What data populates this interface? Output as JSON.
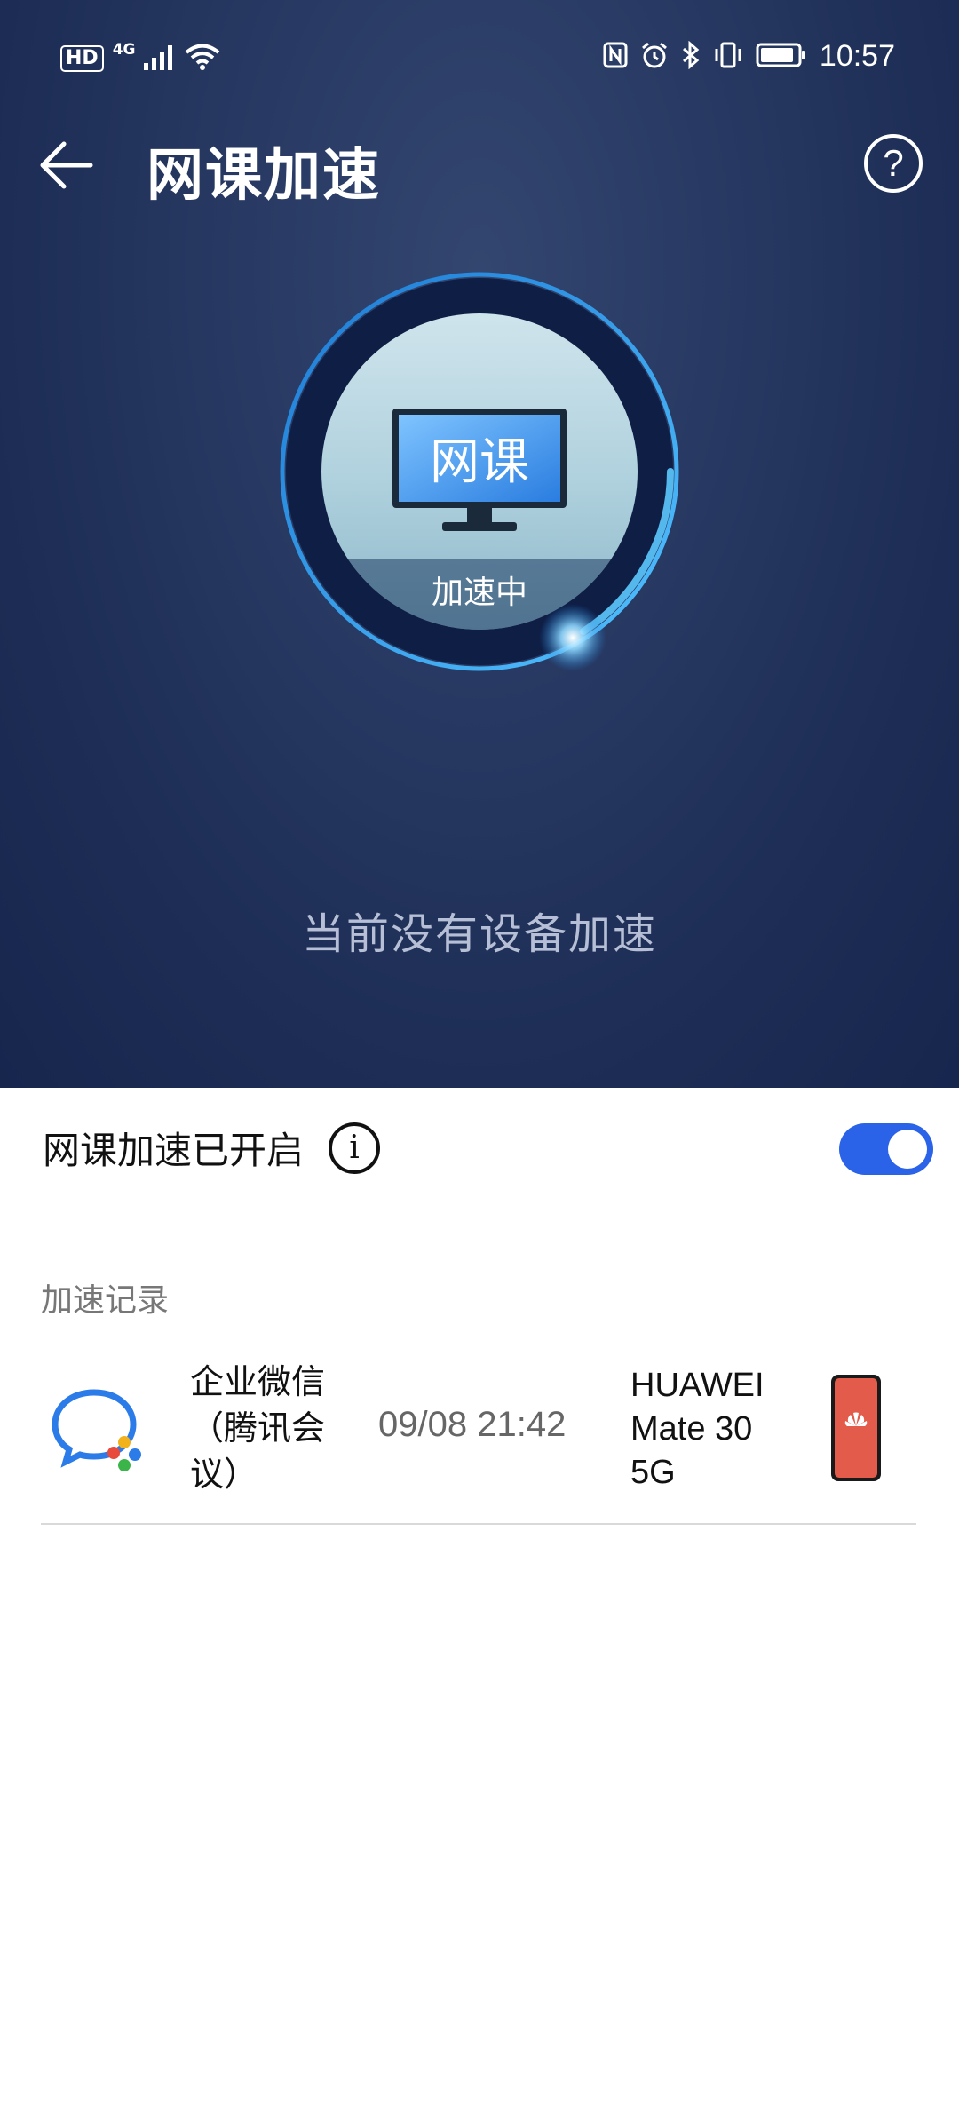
{
  "status_bar": {
    "hd": "HD",
    "network": "4G",
    "time": "10:57",
    "battery_level": 0.9
  },
  "header": {
    "title": "网课加速",
    "help_label": "?"
  },
  "accelerator": {
    "monitor_text": "网课",
    "status_text": "加速中",
    "empty_message": "当前没有设备加速"
  },
  "settings": {
    "toggle_label": "网课加速已开启",
    "toggle_on": true,
    "info_label": "i",
    "accent_color": "#2a62e8"
  },
  "records": {
    "section_title": "加速记录",
    "items": [
      {
        "app_name": "企业微信（腾讯会议）",
        "time": "09/08 21:42",
        "device": "HUAWEI Mate 30 5G"
      }
    ]
  }
}
